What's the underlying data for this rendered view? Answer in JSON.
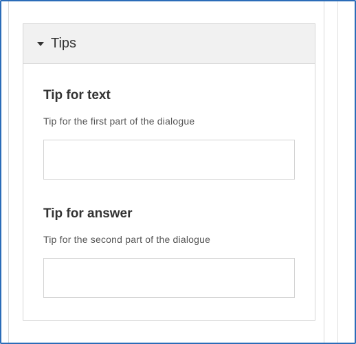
{
  "tips_panel": {
    "header": {
      "title": "Tips",
      "icon": "caret-down-icon"
    },
    "fields": [
      {
        "label": "Tip for text",
        "description": "Tip for the first part of the dialogue",
        "value": "",
        "placeholder": ""
      },
      {
        "label": "Tip for answer",
        "description": "Tip for the second part of the dialogue",
        "value": "",
        "placeholder": ""
      }
    ]
  },
  "colors": {
    "frame_border": "#2b6cb8",
    "header_background": "#f1f1f1",
    "input_border": "#d3d3d3",
    "text": "#333333"
  }
}
